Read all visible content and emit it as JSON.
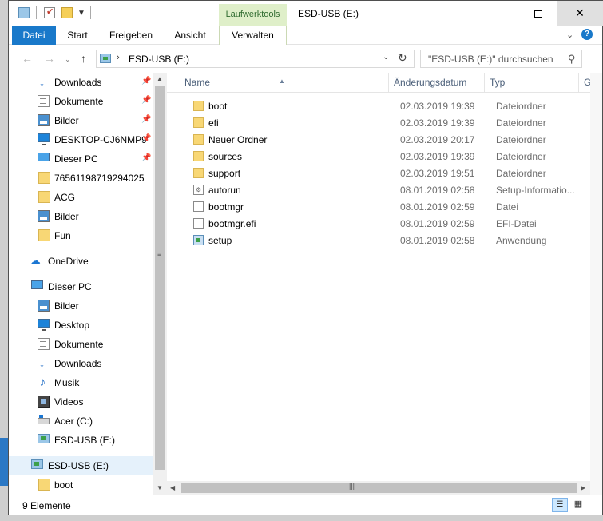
{
  "window": {
    "title": "ESD-USB (E:)",
    "context_tab_title": "Laufwerktools"
  },
  "ribbon": {
    "tabs": [
      "Datei",
      "Start",
      "Freigeben",
      "Ansicht",
      "Verwalten"
    ]
  },
  "address_bar": {
    "path": "ESD-USB (E:)",
    "chevron": "›",
    "refresh_icon": "refresh-icon"
  },
  "search": {
    "placeholder": "\"ESD-USB (E:)\" durchsuchen"
  },
  "nav_pane": {
    "quick_access": [
      {
        "label": "Downloads",
        "icon": "download-icon",
        "pinned": true
      },
      {
        "label": "Dokumente",
        "icon": "documents-icon",
        "pinned": true
      },
      {
        "label": "Bilder",
        "icon": "pictures-icon",
        "pinned": true
      },
      {
        "label": "DESKTOP-CJ6NMP9",
        "icon": "computer-icon",
        "pinned": true
      },
      {
        "label": "Dieser PC",
        "icon": "pc-icon",
        "pinned": true
      },
      {
        "label": "76561198719294025",
        "icon": "folder-icon",
        "pinned": false
      },
      {
        "label": "ACG",
        "icon": "folder-icon",
        "pinned": false
      },
      {
        "label": "Bilder",
        "icon": "pictures-icon",
        "pinned": false
      },
      {
        "label": "Fun",
        "icon": "folder-icon",
        "pinned": false
      }
    ],
    "onedrive": {
      "label": "OneDrive",
      "icon": "cloud-icon"
    },
    "this_pc": {
      "label": "Dieser PC",
      "icon": "pc-icon"
    },
    "this_pc_children": [
      {
        "label": "Bilder",
        "icon": "pictures-icon"
      },
      {
        "label": "Desktop",
        "icon": "desktop-icon"
      },
      {
        "label": "Dokumente",
        "icon": "documents-icon"
      },
      {
        "label": "Downloads",
        "icon": "download-icon"
      },
      {
        "label": "Musik",
        "icon": "music-icon"
      },
      {
        "label": "Videos",
        "icon": "video-icon"
      },
      {
        "label": "Acer (C:)",
        "icon": "drive-icon"
      },
      {
        "label": "ESD-USB (E:)",
        "icon": "usb-drive-icon"
      }
    ],
    "usb_root": {
      "label": "ESD-USB (E:)",
      "icon": "usb-drive-icon"
    },
    "usb_children": [
      {
        "label": "boot",
        "icon": "folder-icon"
      }
    ]
  },
  "file_list": {
    "columns": [
      "Name",
      "Änderungsdatum",
      "Typ",
      "G"
    ],
    "rows": [
      {
        "name": "boot",
        "date": "02.03.2019 19:39",
        "type": "Dateiordner",
        "kind": "folder"
      },
      {
        "name": "efi",
        "date": "02.03.2019 19:39",
        "type": "Dateiordner",
        "kind": "folder"
      },
      {
        "name": "Neuer Ordner",
        "date": "02.03.2019 20:17",
        "type": "Dateiordner",
        "kind": "folder"
      },
      {
        "name": "sources",
        "date": "02.03.2019 19:39",
        "type": "Dateiordner",
        "kind": "folder"
      },
      {
        "name": "support",
        "date": "02.03.2019 19:51",
        "type": "Dateiordner",
        "kind": "folder"
      },
      {
        "name": "autorun",
        "date": "08.01.2019 02:58",
        "type": "Setup-Informatio...",
        "kind": "ini"
      },
      {
        "name": "bootmgr",
        "date": "08.01.2019 02:59",
        "type": "Datei",
        "kind": "file"
      },
      {
        "name": "bootmgr.efi",
        "date": "08.01.2019 02:59",
        "type": "EFI-Datei",
        "kind": "file"
      },
      {
        "name": "setup",
        "date": "08.01.2019 02:58",
        "type": "Anwendung",
        "kind": "exe"
      }
    ]
  },
  "status_bar": {
    "item_count": "9 Elemente"
  }
}
